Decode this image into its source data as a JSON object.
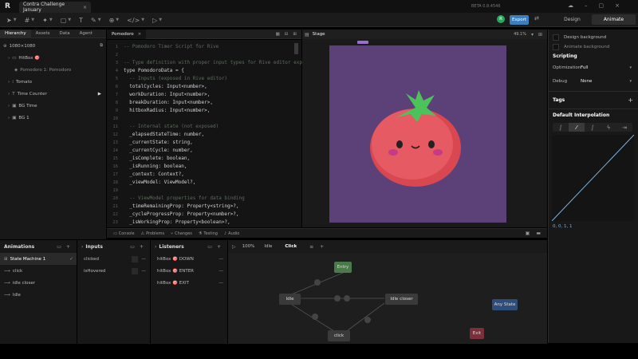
{
  "window": {
    "tab_title": "Contra Challenge January",
    "app_logo": "R",
    "beta_label": "BETA 0.8.4546"
  },
  "toolbar": {
    "user_initial": "R",
    "export_label": "Export",
    "mode_design": "Design",
    "mode_animate": "Animate"
  },
  "hierarchy": {
    "tabs": [
      "Hierarchy",
      "Assets",
      "Data",
      "Agent"
    ],
    "artboard_size": "1080×1080",
    "items": [
      {
        "label": "HitBox 🎯",
        "indent": 1,
        "icon": "box-icon"
      },
      {
        "label": "Pomodoro 1: Pomodoro",
        "indent": 2,
        "icon": "component-icon"
      },
      {
        "label": "Tomato",
        "indent": 1,
        "icon": "group-icon"
      },
      {
        "label": "Time Counter",
        "indent": 1,
        "icon": "text-icon"
      },
      {
        "label": "BG Time",
        "indent": 1,
        "icon": "shape-icon"
      },
      {
        "label": "BG 1",
        "indent": 1,
        "icon": "shape-icon"
      }
    ]
  },
  "code_tab": {
    "label": "Pomodoro"
  },
  "code": {
    "lines": [
      {
        "n": "1",
        "t": "-- Pomodoro Timer Script for Rive",
        "c": "cm"
      },
      {
        "n": "2",
        "t": "",
        "c": ""
      },
      {
        "n": "3",
        "t": "-- Type definition with proper input types for Rive editor exposure",
        "c": "cm"
      },
      {
        "n": "4",
        "t": "type PomodoroData = {",
        "c": ""
      },
      {
        "n": "5",
        "t": "  -- Inputs (exposed in Rive editor)",
        "c": "cm"
      },
      {
        "n": "6",
        "t": "  totalCycles: Input<number>,",
        "c": ""
      },
      {
        "n": "7",
        "t": "  workDuration: Input<number>,",
        "c": ""
      },
      {
        "n": "8",
        "t": "  breakDuration: Input<number>,",
        "c": ""
      },
      {
        "n": "9",
        "t": "  hitboxRadius: Input<number>,",
        "c": ""
      },
      {
        "n": "10",
        "t": "",
        "c": ""
      },
      {
        "n": "11",
        "t": "  -- Internal state (not exposed)",
        "c": "cm"
      },
      {
        "n": "12",
        "t": "  _elapsedStateTime: number,",
        "c": ""
      },
      {
        "n": "13",
        "t": "  _currentState: string,",
        "c": ""
      },
      {
        "n": "14",
        "t": "  _currentCycle: number,",
        "c": ""
      },
      {
        "n": "15",
        "t": "  _isComplete: boolean,",
        "c": ""
      },
      {
        "n": "16",
        "t": "  _isRunning: boolean,",
        "c": ""
      },
      {
        "n": "17",
        "t": "  _context: Context?,",
        "c": ""
      },
      {
        "n": "18",
        "t": "  _viewModel: ViewModel?,",
        "c": ""
      },
      {
        "n": "19",
        "t": "",
        "c": ""
      },
      {
        "n": "20",
        "t": "  -- ViewModel properties for data binding",
        "c": "cm"
      },
      {
        "n": "21",
        "t": "  _timeRemainingProp: Property<string>?,",
        "c": ""
      },
      {
        "n": "22",
        "t": "  _cycleProgressProp: Property<number>?,",
        "c": ""
      },
      {
        "n": "23",
        "t": "  _isWorkingProp: Property<boolean>?,",
        "c": ""
      }
    ]
  },
  "stage": {
    "tab_label": "Stage",
    "zoom": "49.1%"
  },
  "bottom_tabs": [
    "Console",
    "Problems",
    "Changes",
    "Testing",
    "Audio"
  ],
  "right_panel": {
    "design_background": "Design background",
    "animate_background": "Animate background",
    "scripting_title": "Scripting",
    "optimization_label": "Optimization",
    "optimization_value": "Full",
    "debug_label": "Debug",
    "debug_value": "None",
    "tags_title": "Tags",
    "interp_title": "Default Interpolation",
    "interp_values": "0, 0, 1, 1"
  },
  "animations": {
    "title": "Animations",
    "items": [
      "State Machine 1",
      "click",
      "idle closer",
      "Idle"
    ]
  },
  "inputs": {
    "title": "Inputs",
    "items": [
      "clicked",
      "isHovered"
    ]
  },
  "listeners": {
    "title": "Listeners",
    "items": [
      "hitBox 🎯 DOWN",
      "hitBox 🎯 ENTER",
      "hitBox 🎯 EXIT"
    ]
  },
  "graph": {
    "zoom": "100%",
    "tab_idle": "Idle",
    "tab_click": "Click",
    "nodes": {
      "entry": "Entry",
      "idle": "Idle",
      "idle_closer": "Idle closer",
      "click": "click",
      "any_state": "Any State",
      "exit": "Exit"
    }
  },
  "colors": {
    "accent": "#3b7fbf",
    "canvas_bg": "#5b4178",
    "tomato": "#e0505a",
    "leaf": "#4cc25a"
  }
}
